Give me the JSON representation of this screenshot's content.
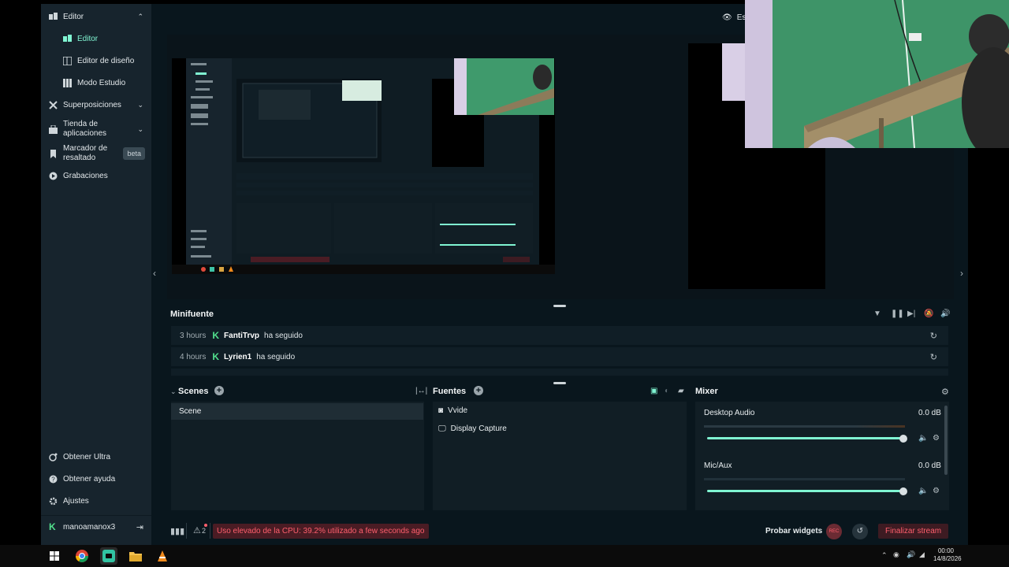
{
  "sidebar": {
    "editor_section": "Editor",
    "items": [
      {
        "label": "Editor",
        "active": true
      },
      {
        "label": "Editor de diseño"
      },
      {
        "label": "Modo Estudio"
      }
    ],
    "overlays": "Superposiciones",
    "app_store": "Tienda de aplicaciones",
    "highlighter": "Marcador de resaltado",
    "beta": "beta",
    "recordings": "Grabaciones",
    "ultra": "Obtener Ultra",
    "help": "Obtener ayuda",
    "settings": "Ajustes",
    "user": "manoamanox3"
  },
  "topbar": {
    "studio_mode_label": "Es"
  },
  "minifuente": {
    "title": "Minifuente",
    "events": [
      {
        "time": "3 hours",
        "name": "FantiTrvp",
        "action": "ha seguido"
      },
      {
        "time": "4 hours",
        "name": "Lyrien1",
        "action": "ha seguido"
      }
    ]
  },
  "scenes": {
    "title": "Scenes",
    "items": [
      "Scene"
    ]
  },
  "sources": {
    "title": "Fuentes",
    "items": [
      {
        "label": "Vvide",
        "icon": "webcam-icon"
      },
      {
        "label": "Display Capture",
        "icon": "monitor-icon"
      }
    ]
  },
  "mixer": {
    "title": "Mixer",
    "channels": [
      {
        "label": "Desktop Audio",
        "db": "0.0 dB",
        "level": 1.0
      },
      {
        "label": "Mic/Aux",
        "db": "0.0 dB",
        "level": 1.0
      }
    ]
  },
  "footer": {
    "alerts": "2",
    "cpu_warning": "Uso elevado de la CPU: 39.2% utilizado a few seconds ago",
    "test_widgets": "Probar widgets",
    "rec": "REC",
    "end_stream": "Finalizar stream"
  },
  "taskbar": {
    "time": "00:00",
    "date": "14/8/2026"
  },
  "colors": {
    "accent": "#80f5d2",
    "error": "#ff5f6d",
    "streamlabs": "#52e08d"
  }
}
